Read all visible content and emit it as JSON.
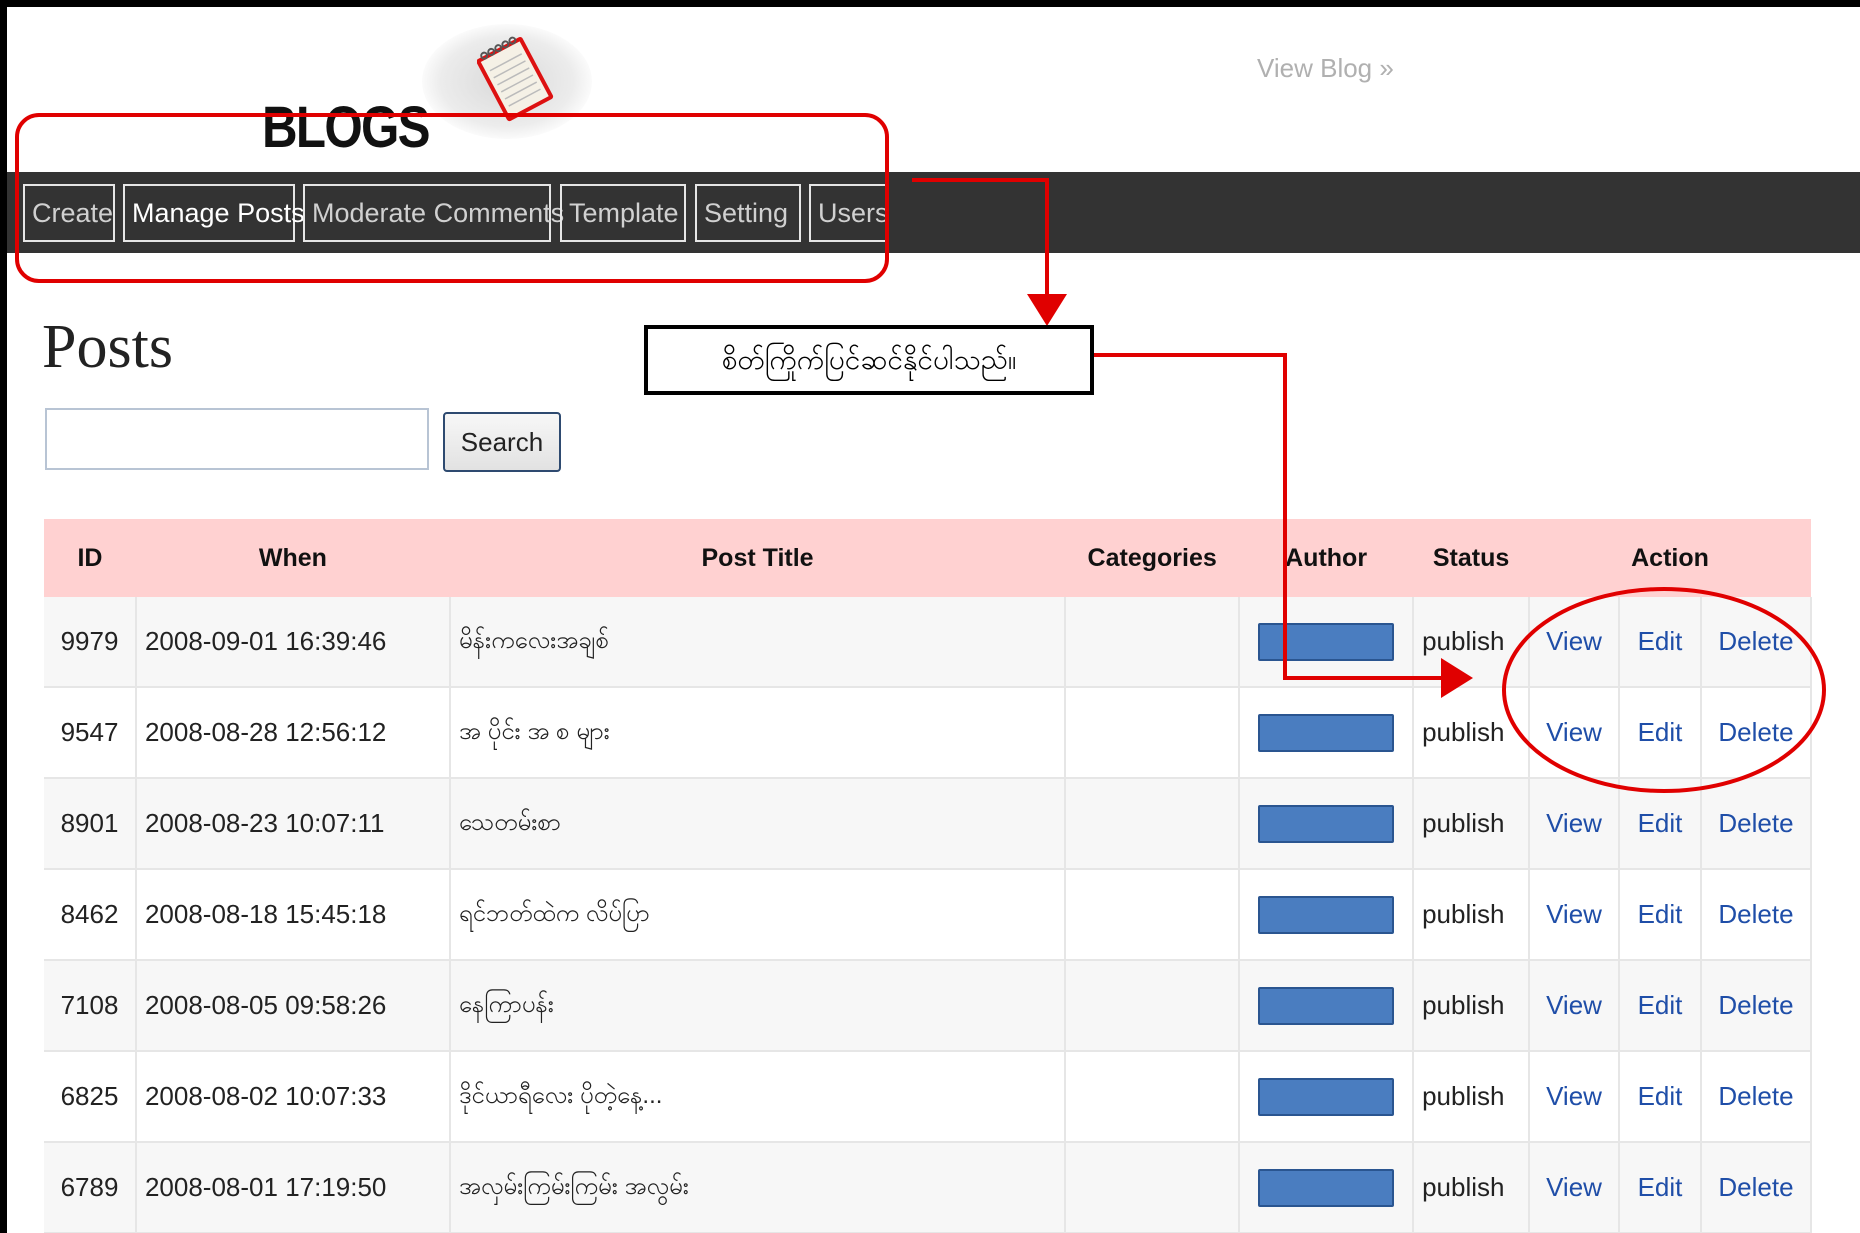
{
  "header": {
    "logo_text": "BLOGS",
    "view_blog": "View Blog »"
  },
  "nav": {
    "tabs": [
      {
        "label": "Create"
      },
      {
        "label": "Manage Posts",
        "active": true
      },
      {
        "label": "Moderate Comments"
      },
      {
        "label": "Template"
      },
      {
        "label": "Setting"
      },
      {
        "label": "Users"
      }
    ]
  },
  "main": {
    "title": "Posts",
    "search": {
      "value": "",
      "button_label": "Search"
    }
  },
  "table": {
    "headers": {
      "id": "ID",
      "when": "When",
      "title": "Post Title",
      "categories": "Categories",
      "author": "Author",
      "status": "Status",
      "action": "Action"
    },
    "rows": [
      {
        "id": "9979",
        "when": "2008-09-01 16:39:46",
        "title": "မိန်းကလေးအချစ်",
        "categories": "",
        "status": "publish",
        "view": "View",
        "edit": "Edit",
        "delete": "Delete"
      },
      {
        "id": "9547",
        "when": "2008-08-28 12:56:12",
        "title": "အ ပိုင်း အ စ များ",
        "categories": "",
        "status": "publish",
        "view": "View",
        "edit": "Edit",
        "delete": "Delete"
      },
      {
        "id": "8901",
        "when": "2008-08-23 10:07:11",
        "title": "သေတမ်းစာ",
        "categories": "",
        "status": "publish",
        "view": "View",
        "edit": "Edit",
        "delete": "Delete"
      },
      {
        "id": "8462",
        "when": "2008-08-18 15:45:18",
        "title": "ရင်ဘတ်ထဲက လိပ်ပြာ",
        "categories": "",
        "status": "publish",
        "view": "View",
        "edit": "Edit",
        "delete": "Delete"
      },
      {
        "id": "7108",
        "when": "2008-08-05 09:58:26",
        "title": "နေကြာပန်း",
        "categories": "",
        "status": "publish",
        "view": "View",
        "edit": "Edit",
        "delete": "Delete"
      },
      {
        "id": "6825",
        "when": "2008-08-02 10:07:33",
        "title": "ဒိုင်ယာရီလေး ပိုတဲ့နေ့...",
        "categories": "",
        "status": "publish",
        "view": "View",
        "edit": "Edit",
        "delete": "Delete"
      },
      {
        "id": "6789",
        "when": "2008-08-01 17:19:50",
        "title": "အလှမ်းကြမ်းကြမ်း အလွမ်း",
        "categories": "",
        "status": "publish",
        "view": "View",
        "edit": "Edit",
        "delete": "Delete"
      }
    ]
  },
  "annotation": {
    "callout_text": "စိတ်ကြိုက်ပြင်ဆင်နိုင်ပါသည်။",
    "color": "#e00000"
  },
  "colors": {
    "navbar": "#333333",
    "table_header": "#ffd1d1",
    "link": "#1f4ea8",
    "author_redaction": "#4a7dc0"
  }
}
